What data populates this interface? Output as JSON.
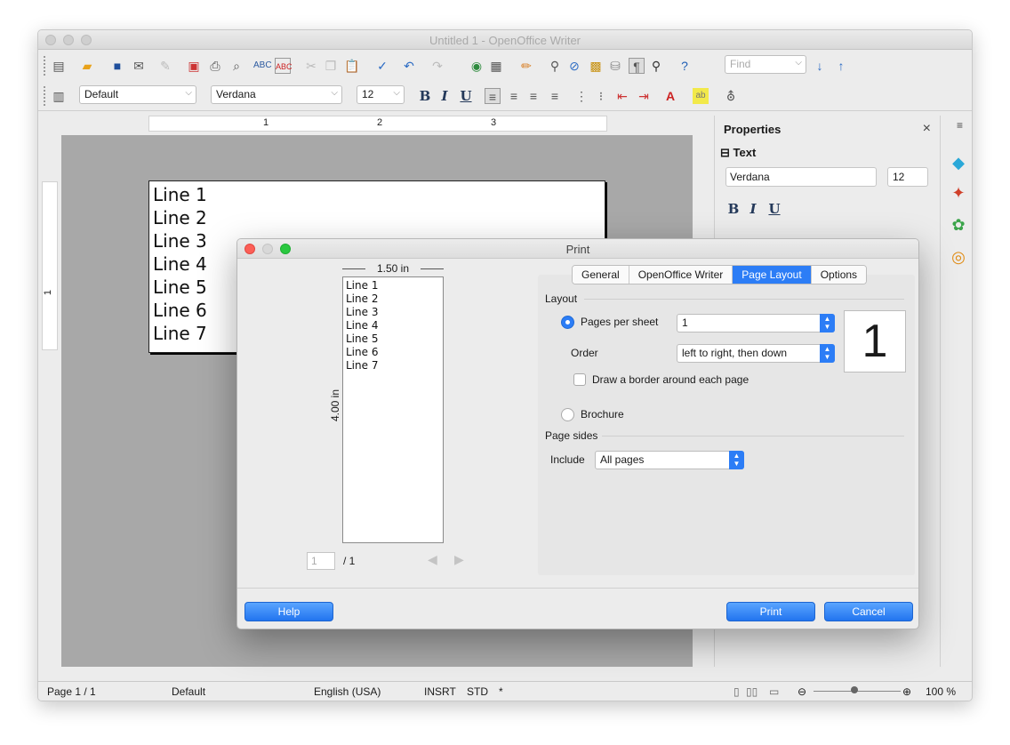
{
  "window": {
    "title": "Untitled 1 - OpenOffice Writer"
  },
  "toolbar": {
    "find_placeholder": "Find",
    "para_style": "Default",
    "font_name": "Verdana",
    "font_size": "12",
    "bold": "B",
    "italic": "I",
    "underline": "U"
  },
  "ruler": {
    "ticks": [
      "1",
      "2",
      "3"
    ],
    "vtick": "1"
  },
  "document": {
    "lines": [
      "Line 1",
      "Line 2",
      "Line 3",
      "Line 4",
      "Line 5",
      "Line 6",
      "Line 7"
    ]
  },
  "sidebar": {
    "title": "Properties",
    "close": "×",
    "section": "Text",
    "font_name": "Verdana",
    "font_size": "12"
  },
  "statusbar": {
    "page": "Page 1 / 1",
    "style": "Default",
    "language": "English (USA)",
    "insert_mode": "INSRT",
    "selection_mode": "STD",
    "modified": "*",
    "zoom": "100 %"
  },
  "dialog": {
    "title": "Print",
    "preview": {
      "width_label": "1.50 in",
      "height_label": "4.00 in",
      "lines": [
        "Line 1",
        "Line 2",
        "Line 3",
        "Line 4",
        "Line 5",
        "Line 6",
        "Line 7"
      ],
      "page_input": "1",
      "page_total": "/ 1"
    },
    "tabs": [
      "General",
      "OpenOffice Writer",
      "Page Layout",
      "Options"
    ],
    "active_tab": "Page Layout",
    "layout": {
      "section_label": "Layout",
      "pages_per_sheet_label": "Pages per sheet",
      "pages_per_sheet_value": "1",
      "order_label": "Order",
      "order_value": "left to right, then down",
      "border_label": "Draw a border around each page",
      "brochure_label": "Brochure",
      "preview_number": "1"
    },
    "page_sides": {
      "section_label": "Page sides",
      "include_label": "Include",
      "include_value": "All pages"
    },
    "buttons": {
      "help": "Help",
      "print": "Print",
      "cancel": "Cancel"
    }
  },
  "colors": {
    "accent": "#2c7df6",
    "close_dot": "#fc5f57",
    "min_dot": "#d8d8d8",
    "max_dot": "#2ac840"
  }
}
